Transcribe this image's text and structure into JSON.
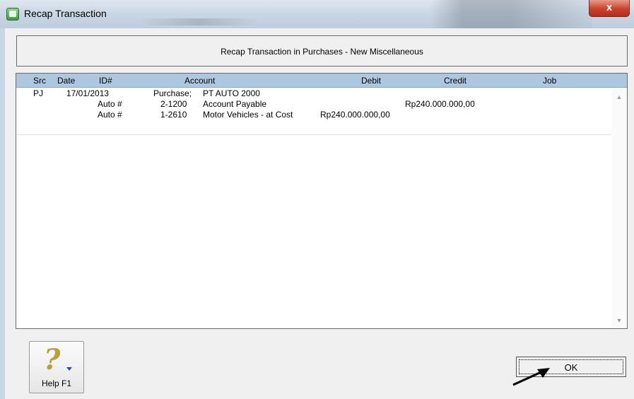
{
  "window": {
    "title": "Recap Transaction",
    "close_label": "x"
  },
  "header": {
    "text": "Recap Transaction in Purchases - New Miscellaneous"
  },
  "grid": {
    "columns": {
      "src": "Src",
      "date": "Date",
      "id": "ID#",
      "account": "Account",
      "debit": "Debit",
      "credit": "Credit",
      "job": "Job"
    },
    "rows": [
      {
        "src": "PJ",
        "date": "17/01/2013",
        "id": "",
        "acct_no": "Purchase;",
        "acct_name": "PT AUTO 2000",
        "debit": "",
        "credit": ""
      },
      {
        "src": "",
        "date": "",
        "id": "Auto #",
        "acct_no": "2-1200",
        "acct_name": "Account Payable",
        "debit": "",
        "credit": "Rp240.000.000,00"
      },
      {
        "src": "",
        "date": "",
        "id": "Auto #",
        "acct_no": "1-2610",
        "acct_name": "Motor Vehicles - at Cost",
        "debit": "Rp240.000.000,00",
        "credit": ""
      }
    ]
  },
  "footer": {
    "help_label": "Help F1",
    "help_glyph": "?",
    "ok_label": "OK"
  },
  "colors": {
    "grid_header": "#aec7e1",
    "close_button": "#c9412b"
  }
}
